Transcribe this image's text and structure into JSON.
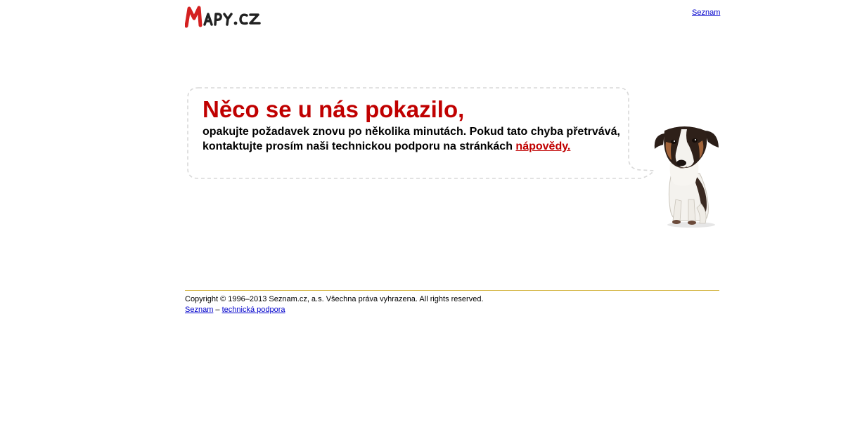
{
  "header": {
    "logo_text": "MAPY.CZ",
    "top_link": "Seznam"
  },
  "error": {
    "headline": "Něco se u nás pokazilo,",
    "message_line1": "opakujte požadavek znovu po několika minutách. Pokud tato chyba přetrvává,",
    "message_line2": "kontaktujte prosím naši technickou podporu na stránkách ",
    "help_link": "nápovědy."
  },
  "footer": {
    "copyright": "Copyright © 1996–2013 Seznam.cz, a.s. Všechna práva vyhrazena. All rights reserved.",
    "link_seznam": "Seznam",
    "separator": "–",
    "link_support": "technická podpora"
  },
  "colors": {
    "accent_red": "#c00000",
    "link_blue": "#0000cc",
    "footer_rule": "#d6b84a",
    "bubble_border": "#d8d8d8"
  },
  "icons": {
    "logo": "mapy-cz-logo",
    "dog": "dog-illustration"
  }
}
